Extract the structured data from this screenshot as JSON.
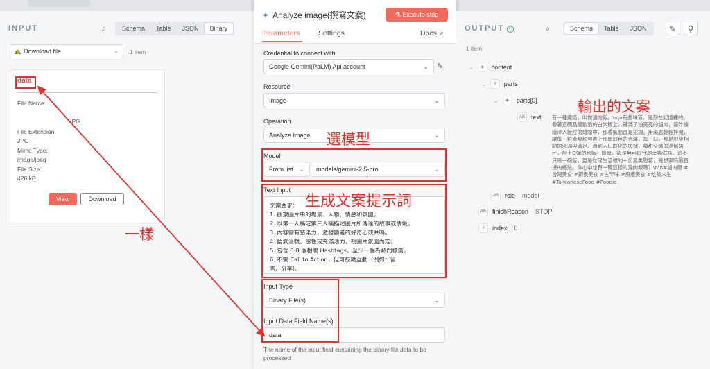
{
  "input": {
    "title": "INPUT",
    "view_tabs": [
      "Schema",
      "Table",
      "JSON",
      "Binary"
    ],
    "active_view": "Binary",
    "source_dropdown": "Download file",
    "item_count": "1 item",
    "file_card": {
      "name": "data",
      "file_name_label": "File Name:",
      "file_name_value": ".JPG",
      "extension_label": "File Extension:",
      "extension_value": "JPG",
      "mime_label": "Mime Type:",
      "mime_value": "image/jpeg",
      "size_label": "File Size:",
      "size_value": "428 kB",
      "view_button": "View",
      "download_button": "Download"
    }
  },
  "node": {
    "title": "Analyze image(撰寫文案)",
    "execute_button": "Execute step",
    "tabs": {
      "parameters": "Parameters",
      "settings": "Settings",
      "docs": "Docs"
    },
    "credential_label": "Credential to connect with",
    "credential_value": "Google Gemini(PaLM) Api account",
    "resource_label": "Resource",
    "resource_value": "Image",
    "operation_label": "Operation",
    "operation_value": "Analyze Image",
    "model_label": "Model",
    "model_mode": "From list",
    "model_value": "models/gemini-2.5-pro",
    "text_input_label": "Text Input",
    "text_input_value": "文案要求：\n1. 觀察圖片中的場景、人物、情感和氛圍。\n2. 以第一人稱或第三人稱描述圖片所傳達的故事或情境。\n3. 內容需有感染力，激發讀者的好奇心或共鳴。\n4. 語氣溫暖、感性或充滿活力，視圖片氛圍而定。\n5. 包含 5-8 個相關 Hashtags，至少一個為熱門標籤。\n6. 不需 Call to Action，但可鼓勵互動（例如：留\n言、分享）。",
    "input_type_label": "Input Type",
    "input_type_value": "Binary File(s)",
    "field_name_label": "Input Data Field Name(s)",
    "field_name_value": "data",
    "field_hint": "The name of the input field containing the binary file data to be processed"
  },
  "output": {
    "title": "OUTPUT",
    "view_tabs": [
      "Schema",
      "Table",
      "JSON"
    ],
    "active_view": "Schema",
    "item_count": "1 item",
    "tree": {
      "content": "content",
      "parts": "parts",
      "parts0": "parts[0]",
      "text": "text",
      "text_value": "有一種療癒，叫做滷肉飯。\\n\\n有些味道，是刻在記憶裡的。看著這碗晶瑩剔透的白米飯上，鋪滿了油亮亮的滷肉，醬汁緩緩滲入飯粒的縫隙中，那香氣簡直是犯規。用湯匙輕輕拌開，讓每一粒米都均勻裹上那琥珀色的光澤，每一口，都是肥瘦相間的溫潤與滿足，過到入口即化的肉塊，鹹甜交織的濃郁醬汁，配上Q彈的米飯，簡單，卻是無可取代的幸福滋味。這不只是一碗飯，更是忙碌生活裡的一份溫柔慰藉，是想家時最直接的鄉愁。你心中也有一碗這樣的滷肉飯嗎？\\n\\n#滷肉飯 #台灣美食 #銅板美食 #古早味 #療癒美食 #吃貨人生 #TaiwaneseFood #Foodie",
      "role": "role",
      "role_value": "model",
      "finish": "finishReason",
      "finish_value": "STOP",
      "index": "index",
      "index_value": "0"
    }
  },
  "annotations": {
    "select_model": "選模型",
    "prompt": "生成文案提示詞",
    "same": "一樣",
    "output_text": "輸出的文案"
  },
  "colors": {
    "accent": "#ef6a5a",
    "annotation": "#e8302a"
  }
}
